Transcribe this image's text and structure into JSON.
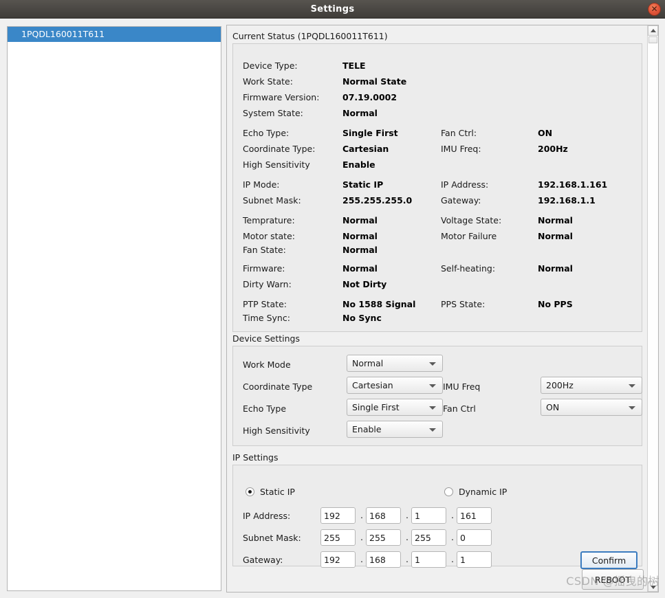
{
  "window": {
    "title": "Settings",
    "close_label": "✕"
  },
  "sidebar": {
    "items": [
      {
        "label": "1PQDL160011T611",
        "selected": true
      }
    ]
  },
  "status_group": {
    "title": "Current Status (1PQDL160011T611)",
    "rows": [
      {
        "label": "Device Type:",
        "value": "TELE"
      },
      {
        "label": "Work State:",
        "value": "Normal State"
      },
      {
        "label": "Firmware Version:",
        "value": "07.19.0002"
      },
      {
        "label": "System State:",
        "value": "Normal"
      },
      {
        "label": "Echo Type:",
        "value": "Single First",
        "label2": "Fan Ctrl:",
        "value2": "ON"
      },
      {
        "label": "Coordinate Type:",
        "value": "Cartesian",
        "label2": "IMU Freq:",
        "value2": "200Hz"
      },
      {
        "label": "High Sensitivity",
        "value": "Enable"
      },
      {
        "label": "IP Mode:",
        "value": "Static IP",
        "label2": "IP Address:",
        "value2": "192.168.1.161"
      },
      {
        "label": "Subnet Mask:",
        "value": "255.255.255.0",
        "label2": "Gateway:",
        "value2": "192.168.1.1"
      },
      {
        "label": "Temprature:",
        "value": "Normal",
        "label2": "Voltage State:",
        "value2": "Normal"
      },
      {
        "label": "Motor state:",
        "value": "Normal",
        "label2": "Motor Failure",
        "value2": "Normal"
      },
      {
        "label": "Fan State:",
        "value": "Normal"
      },
      {
        "label": "Firmware:",
        "value": "Normal",
        "label2": "Self-heating:",
        "value2": "Normal"
      },
      {
        "label": "Dirty Warn:",
        "value": "Not Dirty"
      },
      {
        "label": "PTP State:",
        "value": "No 1588 Signal",
        "label2": "PPS State:",
        "value2": "No PPS"
      },
      {
        "label": "Time Sync:",
        "value": "No Sync"
      }
    ]
  },
  "device_settings": {
    "title": "Device Settings",
    "work_mode": {
      "label": "Work Mode",
      "value": "Normal"
    },
    "coordinate_type": {
      "label": "Coordinate Type",
      "value": "Cartesian"
    },
    "imu_freq": {
      "label": "IMU Freq",
      "value": "200Hz"
    },
    "echo_type": {
      "label": "Echo Type",
      "value": "Single First"
    },
    "fan_ctrl": {
      "label": "Fan Ctrl",
      "value": "ON"
    },
    "high_sensitivity": {
      "label": "High Sensitivity",
      "value": "Enable"
    }
  },
  "ip_settings": {
    "title": "IP Settings",
    "static_label": "Static IP",
    "dynamic_label": "Dynamic IP",
    "mode_selected": "Static IP",
    "ip_address": {
      "label": "IP Address:",
      "o1": "192",
      "o2": "168",
      "o3": "1",
      "o4": "161"
    },
    "subnet_mask": {
      "label": "Subnet Mask:",
      "o1": "255",
      "o2": "255",
      "o3": "255",
      "o4": "0"
    },
    "gateway": {
      "label": "Gateway:",
      "o1": "192",
      "o2": "168",
      "o3": "1",
      "o4": "1"
    },
    "separator": ".",
    "confirm_label": "Confirm"
  },
  "footer": {
    "reboot_label": "REBOOT"
  },
  "watermark": {
    "text": "CSDN @摇曳的树"
  },
  "colors": {
    "titlebar": "#4b4844",
    "selection": "#3a87c8",
    "panel_bg": "#f0f0f0",
    "group_bg": "#ececec",
    "close_button": "#e2563a",
    "focus_border": "#3a7bbf"
  }
}
